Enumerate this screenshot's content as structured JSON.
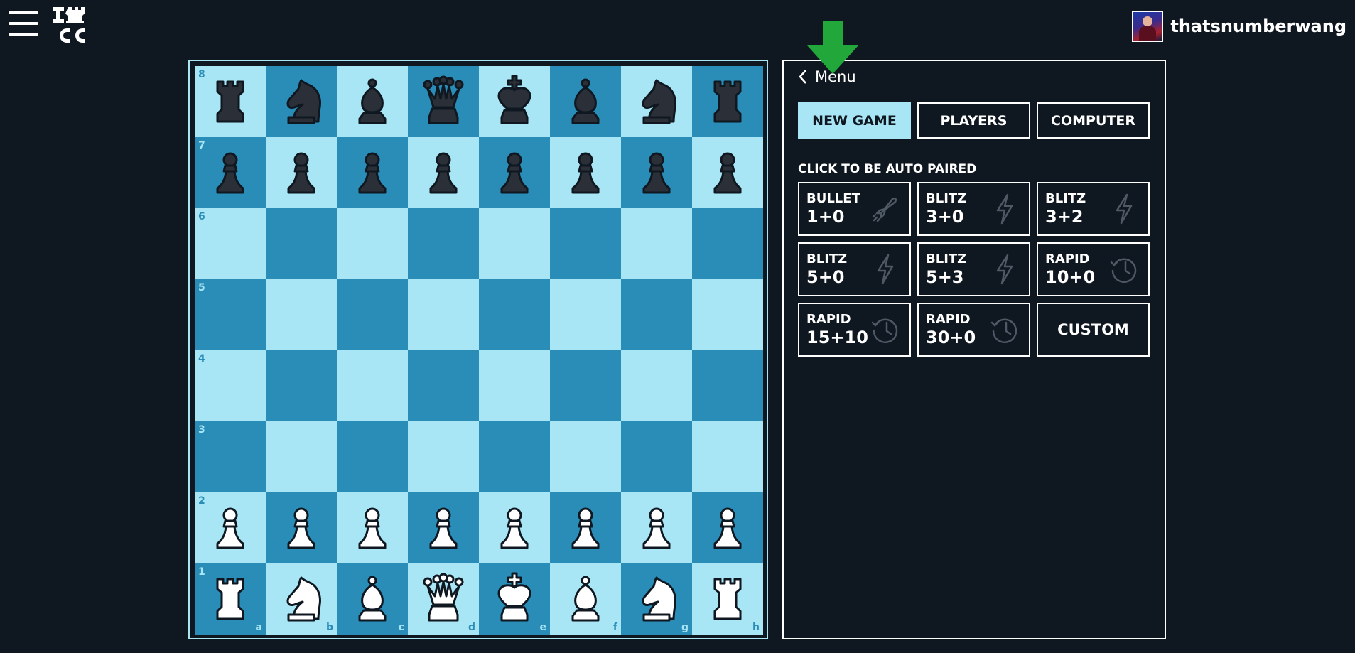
{
  "header": {
    "username": "thatsnumberwang"
  },
  "board": {
    "ranks": [
      "8",
      "7",
      "6",
      "5",
      "4",
      "3",
      "2",
      "1"
    ],
    "files": [
      "a",
      "b",
      "c",
      "d",
      "e",
      "f",
      "g",
      "h"
    ],
    "position": [
      [
        "bR",
        "bN",
        "bB",
        "bQ",
        "bK",
        "bB",
        "bN",
        "bR"
      ],
      [
        "bP",
        "bP",
        "bP",
        "bP",
        "bP",
        "bP",
        "bP",
        "bP"
      ],
      [
        "",
        "",
        "",
        "",
        "",
        "",
        "",
        ""
      ],
      [
        "",
        "",
        "",
        "",
        "",
        "",
        "",
        ""
      ],
      [
        "",
        "",
        "",
        "",
        "",
        "",
        "",
        ""
      ],
      [
        "",
        "",
        "",
        "",
        "",
        "",
        "",
        ""
      ],
      [
        "wP",
        "wP",
        "wP",
        "wP",
        "wP",
        "wP",
        "wP",
        "wP"
      ],
      [
        "wR",
        "wN",
        "wB",
        "wQ",
        "wK",
        "wB",
        "wN",
        "wR"
      ]
    ],
    "colors": {
      "light": "#a8e6f5",
      "dark": "#2a8db8"
    }
  },
  "panel": {
    "back_label": "Menu",
    "tabs": [
      "NEW GAME",
      "PLAYERS",
      "COMPUTER"
    ],
    "active_tab": "NEW GAME",
    "paired_title": "CLICK TO BE AUTO PAIRED",
    "time_controls": [
      {
        "type": "BULLET",
        "time": "1+0",
        "icon": "rocket-icon"
      },
      {
        "type": "BLITZ",
        "time": "3+0",
        "icon": "lightning-icon"
      },
      {
        "type": "BLITZ",
        "time": "3+2",
        "icon": "lightning-icon"
      },
      {
        "type": "BLITZ",
        "time": "5+0",
        "icon": "lightning-icon"
      },
      {
        "type": "BLITZ",
        "time": "5+3",
        "icon": "lightning-icon"
      },
      {
        "type": "RAPID",
        "time": "10+0",
        "icon": "clock-icon"
      },
      {
        "type": "RAPID",
        "time": "15+10",
        "icon": "clock-icon"
      },
      {
        "type": "RAPID",
        "time": "30+0",
        "icon": "clock-icon"
      }
    ],
    "custom_label": "CUSTOM"
  }
}
